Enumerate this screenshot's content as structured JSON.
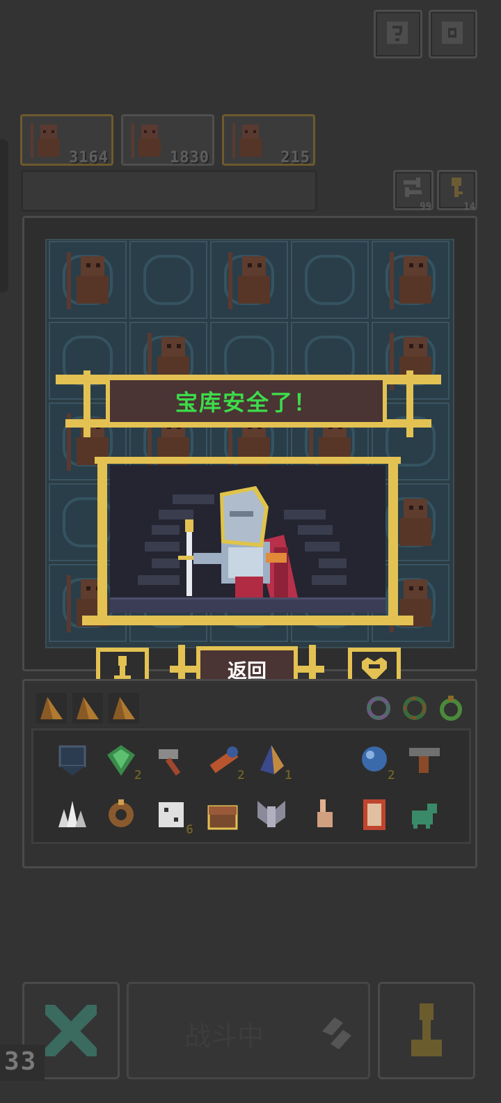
{
  "top_buttons": {
    "help_icon": "question-icon",
    "settings_icon": "gear-icon"
  },
  "troops": [
    {
      "count": "3164"
    },
    {
      "count": "1830"
    },
    {
      "count": "215"
    }
  ],
  "side_buttons": [
    {
      "icon": "swap-icon",
      "count": "99"
    },
    {
      "icon": "key-icon",
      "count": "14"
    }
  ],
  "dialog": {
    "title": "宝库安全了！",
    "back_label": "返回"
  },
  "inventory": {
    "items_row1": [
      {
        "icon": "shield-icon",
        "count": ""
      },
      {
        "icon": "green-gem-icon",
        "count": "2"
      },
      {
        "icon": "hammer-icon",
        "count": ""
      },
      {
        "icon": "telescope-icon",
        "count": "2"
      },
      {
        "icon": "crystal-icon",
        "count": "1"
      },
      {
        "icon": "blue-orb-icon",
        "count": "2"
      },
      {
        "icon": "anvil-icon",
        "count": ""
      }
    ],
    "items_row2": [
      {
        "icon": "crystal-cluster-icon",
        "count": ""
      },
      {
        "icon": "ring-icon",
        "count": ""
      },
      {
        "icon": "dice-icon",
        "count": "6"
      },
      {
        "icon": "chest-icon",
        "count": ""
      },
      {
        "icon": "winged-helm-icon",
        "count": ""
      },
      {
        "icon": "hand-icon",
        "count": ""
      },
      {
        "icon": "scroll-icon",
        "count": ""
      },
      {
        "icon": "dinosaur-icon",
        "count": ""
      }
    ]
  },
  "bottom": {
    "battle_label": "战斗中",
    "counter": "33"
  },
  "colors": {
    "background": "#333333",
    "gold": "#e3c253",
    "title_green": "#3ddc4a",
    "banner_brown": "#4a3434"
  }
}
